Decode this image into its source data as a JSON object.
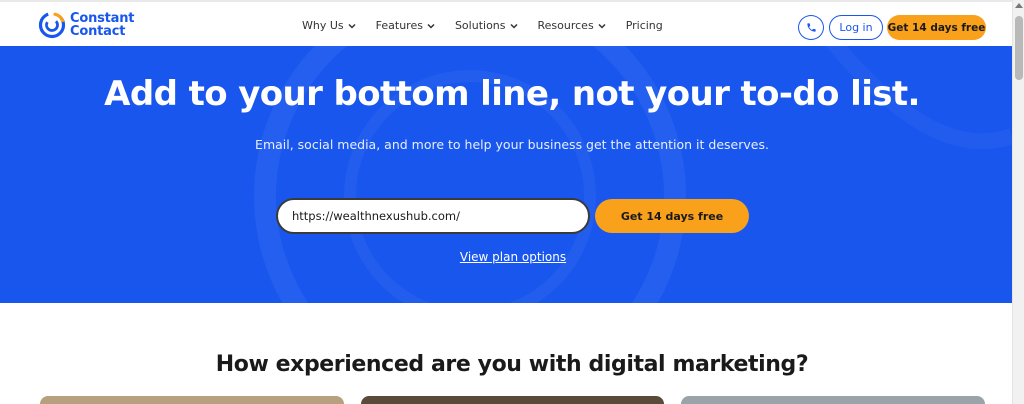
{
  "brand": {
    "line1": "Constant",
    "line2": "Contact",
    "color": "#1856ed"
  },
  "nav": [
    {
      "label": "Why Us",
      "dropdown": true
    },
    {
      "label": "Features",
      "dropdown": true
    },
    {
      "label": "Solutions",
      "dropdown": true
    },
    {
      "label": "Resources",
      "dropdown": true
    },
    {
      "label": "Pricing",
      "dropdown": false
    }
  ],
  "header_actions": {
    "phone_icon": "phone-icon",
    "login_label": "Log in",
    "cta_label": "Get 14 days free"
  },
  "hero": {
    "title": "Add to your bottom line, not your to-do list.",
    "subtitle": "Email, social media, and more to help your business get the attention it deserves.",
    "url_value": "https://wealthnexushub.com/",
    "cta_label": "Get 14 days free",
    "plan_link": "View plan options",
    "background": "#1856ed",
    "accent": "#f9a11b"
  },
  "section": {
    "title": "How experienced are you with digital marketing?"
  }
}
